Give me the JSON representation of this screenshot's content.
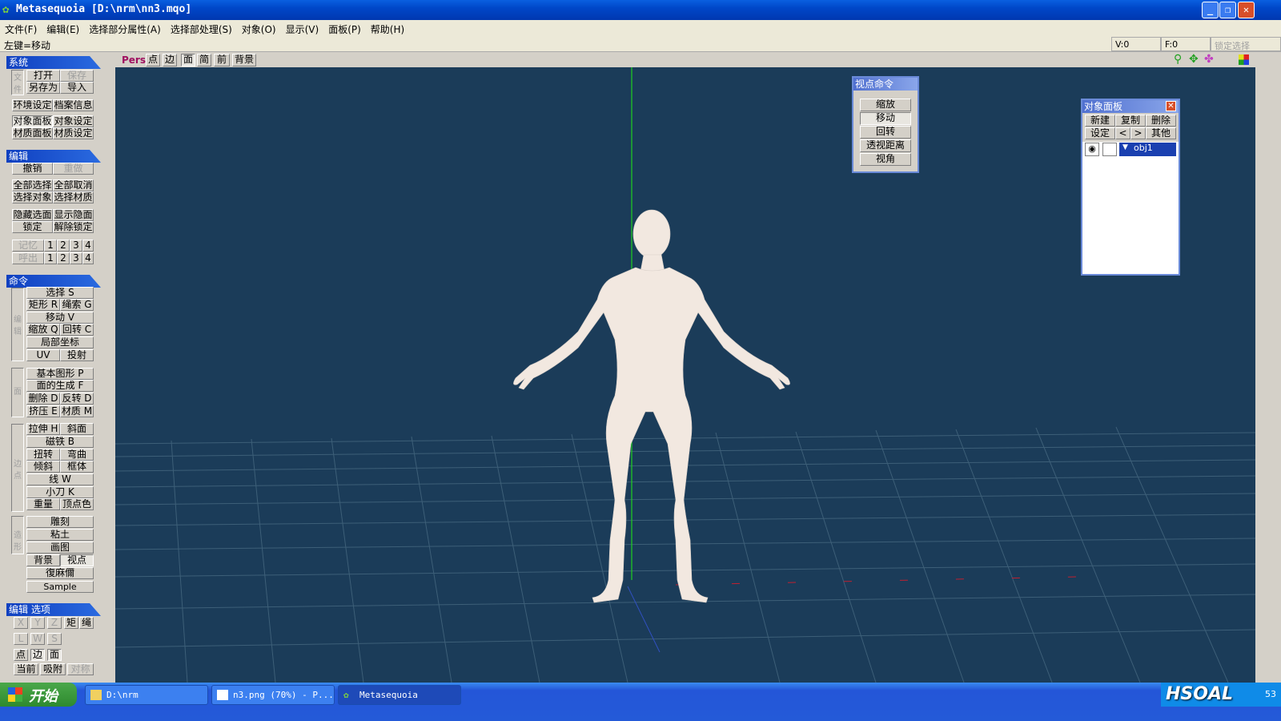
{
  "window": {
    "title": "Metasequoia [D:\\nrm\\nn3.mqo]"
  },
  "menu": [
    "文件(F)",
    "编辑(E)",
    "选择部分属性(A)",
    "选择部处理(S)",
    "对象(O)",
    "显示(V)",
    "面板(P)",
    "帮助(H)"
  ],
  "status": {
    "mode": "左键=移动",
    "v": "V:0",
    "f": "F:0",
    "lock": "锁定选择"
  },
  "panels": {
    "system": {
      "title": "系统",
      "open": "打开",
      "save": "保存",
      "saveas": "另存为",
      "import": "导入",
      "env": "环境设定",
      "fileinfo": "档案信息",
      "objpanel": "对象面板",
      "objset": "对象设定",
      "matpanel": "材质面板",
      "matset": "材质设定",
      "side": "文件"
    },
    "edit": {
      "title": "编辑",
      "undo": "撤销",
      "redo": "重做",
      "selall": "全部选择",
      "deselall": "全部取消",
      "selobj": "选择对象",
      "selmat": "选择材质",
      "hide": "隐藏选面",
      "showhide": "显示隐面",
      "lock": "锁定",
      "unlock": "解除锁定",
      "mem": "记忆",
      "recall": "呼出",
      "n1": "1",
      "n2": "2",
      "n3": "3",
      "n4": "4"
    },
    "cmd": {
      "title": "命令",
      "select": "选择 S",
      "rect": "矩形 R",
      "lasso": "绳索 G",
      "move": "移动 V",
      "scale": "缩放 Q",
      "rotate": "回转 C",
      "local": "局部坐标",
      "uv": "UV",
      "project": "投射",
      "side1": "编辑",
      "basic": "基本图形 P",
      "facegen": "面的生成 F",
      "del": "删除 D",
      "flip": "反转 D",
      "extrude": "挤压 E",
      "material": "材质 M",
      "side2": "面",
      "stretch": "拉伸 H",
      "bevel": "斜面",
      "magnet": "磁铁 B",
      "twist": "扭转",
      "bend": "弯曲",
      "slant": "倾斜",
      "frame": "框体",
      "line": "线 W",
      "knife": "小刀 K",
      "weight": "重量",
      "vcolor": "顶点色",
      "side3": "边点",
      "sculpt": "雕刻",
      "clay": "粘土",
      "paint": "画图",
      "bg": "背景",
      "view": "视点",
      "mirror": "復麻儞",
      "sample": "Sample",
      "side4": "造形"
    },
    "opt": {
      "title": "编辑 选项",
      "x": "X",
      "y": "Y",
      "z": "Z",
      "rect": "矩",
      "rope": "绳",
      "l": "L",
      "w": "W",
      "s": "S",
      "pt": "点",
      "edge": "边",
      "face": "面",
      "cur": "当前",
      "snap": "吸附",
      "sym": "对称"
    }
  },
  "viewbar": {
    "pers": "Pers",
    "items": [
      "点",
      "边",
      "面",
      "简",
      "前",
      "背景"
    ]
  },
  "viewcmd": {
    "title": "视点命令",
    "items": [
      "缩放",
      "移动",
      "回转",
      "透视距离",
      "视角"
    ],
    "active": 1
  },
  "objpanel": {
    "title": "对象面板",
    "new": "新建",
    "copy": "复制",
    "del": "删除",
    "set": "设定",
    "prev": "<",
    "next": ">",
    "other": "其他",
    "obj": "obj1"
  },
  "taskbar": {
    "start": "开始",
    "items": [
      "D:\\nrm",
      "n3.png (70%) - P...",
      "Metasequoia"
    ],
    "watermark": "HSOAL",
    "clock": "53"
  },
  "colors": {
    "viewport": "#1b3c59",
    "grid": "#3a5a72",
    "axis_green": "#1fd01f",
    "skin": "#f0e6de"
  }
}
